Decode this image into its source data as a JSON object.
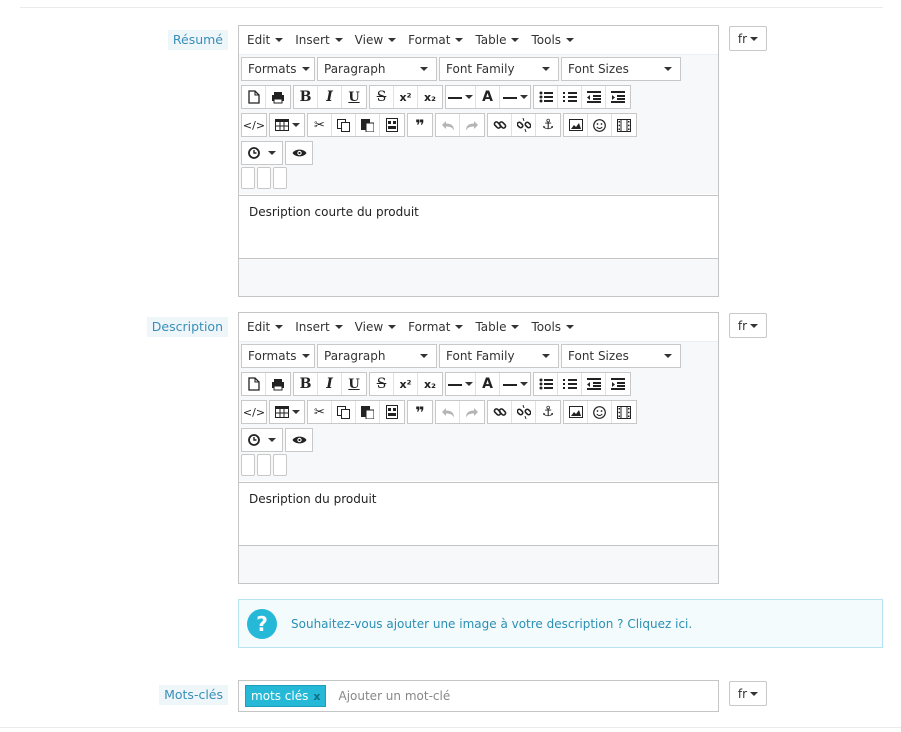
{
  "labels": {
    "summary": "Résumé",
    "description": "Description",
    "keywords": "Mots-clés"
  },
  "menus": [
    "Edit",
    "Insert",
    "View",
    "Format",
    "Table",
    "Tools"
  ],
  "selects": {
    "formats": "Formats",
    "paragraph": "Paragraph",
    "font_family": "Font Family",
    "font_sizes": "Font Sizes"
  },
  "glyphs": {
    "bold": "B",
    "italic": "I",
    "underline": "U",
    "strike": "S",
    "superscript": "x²",
    "subscript": "x₂",
    "text_color": "A",
    "blockquote": "❞",
    "help": "?",
    "remove": "x"
  },
  "icons": [
    "new-document-icon",
    "print-icon",
    "code-icon",
    "table-icon",
    "cut-icon",
    "copy-icon",
    "paste-icon",
    "paste-text-icon",
    "undo-icon",
    "redo-icon",
    "link-icon",
    "unlink-icon",
    "anchor-icon",
    "image-icon",
    "emoticon-icon",
    "media-icon",
    "insert-time-icon",
    "preview-icon"
  ],
  "editors": {
    "summary": {
      "content": "Desription courte du produit"
    },
    "description": {
      "content": "Desription du produit"
    }
  },
  "lang": "fr",
  "info": {
    "text": "Souhaitez-vous ajouter une image à votre description ? Cliquez ici."
  },
  "keywords": {
    "tags": [
      "mots clés"
    ],
    "placeholder": "Ajouter un mot-clé"
  },
  "colors": {
    "accent": "#25b9d7",
    "label": "#3a8eb8"
  }
}
